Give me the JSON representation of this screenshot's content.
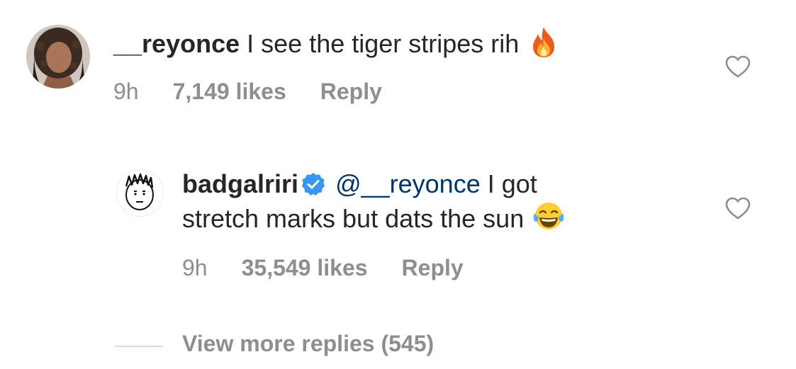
{
  "comments": [
    {
      "username": "__reyonce",
      "text": "I see the tiger stripes rih",
      "emoji": "fire-emoji",
      "time": "9h",
      "likes": "7,149 likes",
      "reply_label": "Reply",
      "avatar": "profile-photo"
    },
    {
      "username": "badgalriri",
      "verified": true,
      "mention": "@__reyonce",
      "text_line1": "I got",
      "text_line2": "stretch marks but dats the sun",
      "emoji": "tears-of-joy-emoji",
      "time": "9h",
      "likes": "35,549 likes",
      "reply_label": "Reply",
      "avatar": "cartoon-face-avatar"
    }
  ],
  "view_more": "View more replies (545)",
  "colors": {
    "text": "#262626",
    "meta": "#8e8e8e",
    "mention": "#003569",
    "verified": "#3897f0",
    "divider": "#dbdbdb"
  },
  "icons": [
    "heart-icon",
    "verified-badge-icon"
  ]
}
